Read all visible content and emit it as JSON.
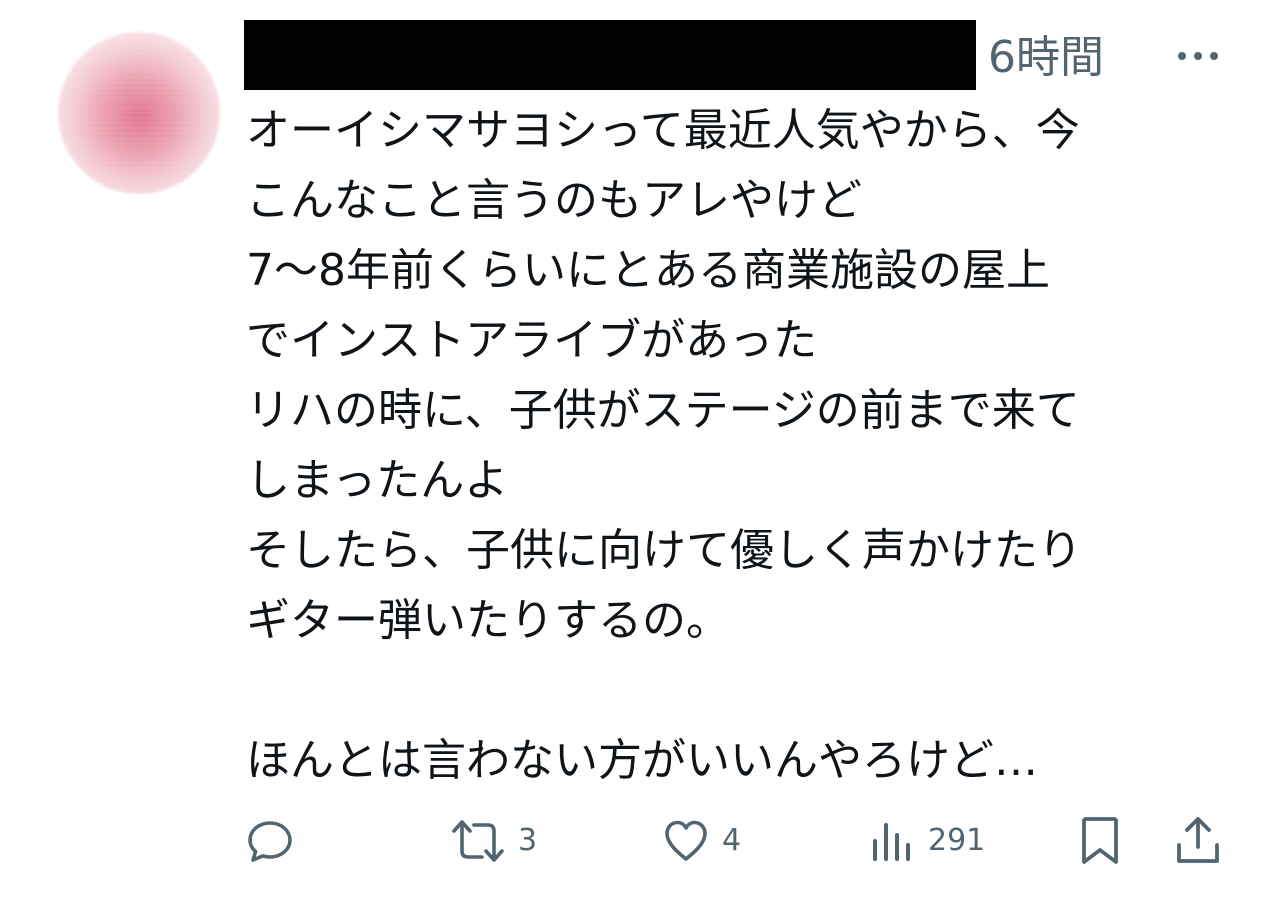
{
  "tweet": {
    "timestamp": "6時間",
    "body_lines": [
      "オーイシマサヨシって最近人気やから、今",
      "こんなこと言うのもアレやけど",
      "7〜8年前くらいにとある商業施設の屋上",
      "でインストアライブがあった",
      "リハの時に、子供がステージの前まで来て",
      "しまったんよ",
      "そしたら、子供に向けて優しく声かけたり",
      "ギター弾いたりするの。",
      "",
      "ほんとは言わない方がいいんやろけど…"
    ]
  },
  "actions": {
    "reply": {
      "icon": "reply-icon",
      "count": ""
    },
    "retweet": {
      "icon": "retweet-icon",
      "count": "3"
    },
    "like": {
      "icon": "heart-icon",
      "count": "4"
    },
    "views": {
      "icon": "views-icon",
      "count": "291"
    },
    "bookmark": {
      "icon": "bookmark-icon"
    },
    "share": {
      "icon": "share-icon"
    }
  },
  "colors": {
    "text": "#0f1419",
    "secondary": "#536471",
    "redaction": "#000000"
  }
}
